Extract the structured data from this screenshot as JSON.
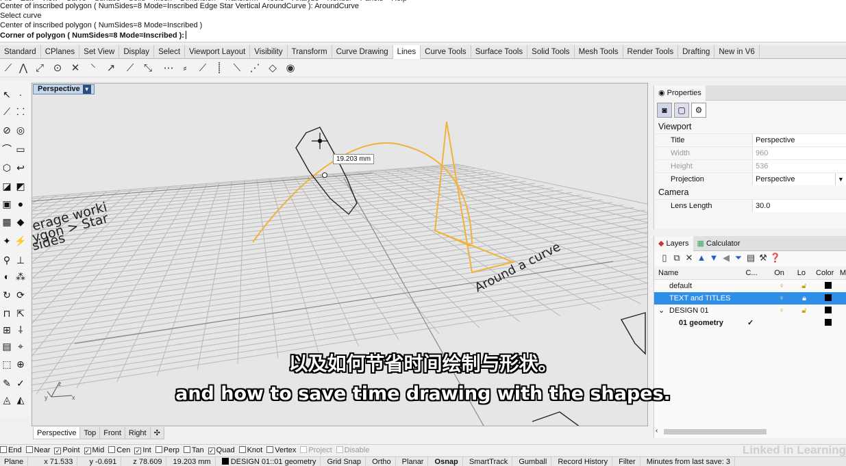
{
  "menu": [
    "File",
    "Edit",
    "View",
    "Curve",
    "Surface",
    "Solid",
    "Mesh",
    "Dimension",
    "Transform",
    "Tools",
    "Analyze",
    "Render",
    "Panels",
    "Help"
  ],
  "command_history": {
    "line1": "Center of inscribed polygon ( NumSides=8  Mode=Inscribed  Edge  Star  Vertical  AroundCurve ): AroundCurve",
    "line2": "Select curve",
    "line3": "Center of inscribed polygon ( NumSides=8  Mode=Inscribed )",
    "prompt": "Corner of polygon ( NumSides=8  Mode=Inscribed ):"
  },
  "tabs": [
    "Standard",
    "CPlanes",
    "Set View",
    "Display",
    "Select",
    "Viewport Layout",
    "Visibility",
    "Transform",
    "Curve Drawing",
    "Lines",
    "Curve Tools",
    "Surface Tools",
    "Solid Tools",
    "Mesh Tools",
    "Render Tools",
    "Drafting",
    "New in V6"
  ],
  "active_tab": "Lines",
  "viewport": {
    "label": "Perspective",
    "dim_tooltip": "19.203 mm",
    "text_around_curve": "Around a curve",
    "text_left_1": "erage worki",
    "text_left_2": "ygon > Star",
    "text_left_3": "sides",
    "axis_x": "x",
    "axis_y": "y",
    "axis_z": "z"
  },
  "viewport_tabs": [
    "Perspective",
    "Top",
    "Front",
    "Right"
  ],
  "viewport_tab_add": "✣",
  "properties": {
    "tabs": [
      "Properties"
    ],
    "section_viewport": "Viewport",
    "rows": [
      {
        "key": "Title",
        "value": "Perspective"
      },
      {
        "key": "Width",
        "value": "960"
      },
      {
        "key": "Height",
        "value": "536"
      },
      {
        "key": "Projection",
        "value": "Perspective"
      }
    ],
    "section_camera": "Camera",
    "lens_key": "Lens Length",
    "lens_value": "30.0"
  },
  "layers": {
    "tabs": [
      "Layers",
      "Calculator"
    ],
    "headers": {
      "name": "Name",
      "c": "C...",
      "on": "On",
      "lo": "Lo",
      "color": "Color",
      "m": "M"
    },
    "rows": [
      {
        "name": "default",
        "check": ""
      },
      {
        "name": "TEXT and TITLES",
        "check": ""
      },
      {
        "name": "DESIGN 01",
        "check": ""
      },
      {
        "name": "01 geometry",
        "check": "✓"
      }
    ]
  },
  "osnaps": [
    {
      "label": "End",
      "checked": false
    },
    {
      "label": "Near",
      "checked": false
    },
    {
      "label": "Point",
      "checked": true
    },
    {
      "label": "Mid",
      "checked": true
    },
    {
      "label": "Cen",
      "checked": false
    },
    {
      "label": "Int",
      "checked": true
    },
    {
      "label": "Perp",
      "checked": false
    },
    {
      "label": "Tan",
      "checked": false
    },
    {
      "label": "Quad",
      "checked": true
    },
    {
      "label": "Knot",
      "checked": false
    },
    {
      "label": "Vertex",
      "checked": false
    },
    {
      "label": "Project",
      "checked": false,
      "disabled": true
    },
    {
      "label": "Disable",
      "checked": false,
      "disabled": true
    }
  ],
  "status": {
    "cplane": "Plane",
    "x": "x 71.533",
    "y": "y -0.691",
    "z": "z 78.609",
    "dist": "19.203 mm",
    "layer": "DESIGN 01::01 geometry",
    "grid_snap": "Grid Snap",
    "ortho": "Ortho",
    "planar": "Planar",
    "osnap": "Osnap",
    "smarttrack": "SmartTrack",
    "gumball": "Gumball",
    "record_history": "Record History",
    "filter": "Filter",
    "minutes": "Minutes from last save: 3"
  },
  "watermark": "Linked in Learning",
  "subtitles": {
    "zh": "以及如何节省时间绘制与形状。",
    "en": "and how to save time drawing with the shapes."
  },
  "colors": {
    "curve": "#f0b23a",
    "selected_layer": "#2f8fe8",
    "grid": "#b8b8b8"
  }
}
